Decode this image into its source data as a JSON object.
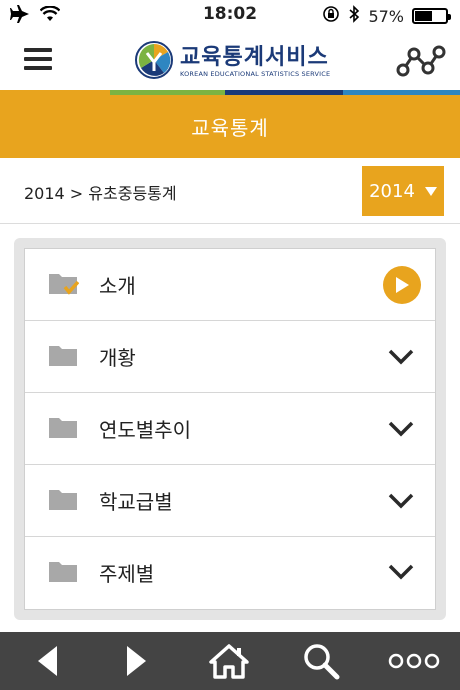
{
  "status_bar": {
    "time": "18:02",
    "battery_percent": "57%",
    "battery_level": 0.57,
    "icons": [
      "airplane-icon",
      "wifi-icon",
      "rotation-lock-icon",
      "bluetooth-icon",
      "battery-icon"
    ]
  },
  "header": {
    "logo_title": "교육통계서비스",
    "logo_subtitle": "KOREAN EDUCATIONAL STATISTICS SERVICE",
    "left_icon": "hamburger-menu-icon",
    "right_icon": "share-icon"
  },
  "stripe_colors": [
    "#e8a41e",
    "#7cb342",
    "#1b3a78",
    "#2e86c1"
  ],
  "page": {
    "title": "교육통계",
    "breadcrumb": "2014 > 유초중등통계",
    "year_selected": "2014"
  },
  "menu": {
    "items": [
      {
        "label": "소개",
        "icon": "folder-checked-icon",
        "action": "play-icon"
      },
      {
        "label": "개황",
        "icon": "folder-icon",
        "action": "chevron-down-icon"
      },
      {
        "label": "연도별추이",
        "icon": "folder-icon",
        "action": "chevron-down-icon"
      },
      {
        "label": "학교급별",
        "icon": "folder-icon",
        "action": "chevron-down-icon"
      },
      {
        "label": "주제별",
        "icon": "folder-icon",
        "action": "chevron-down-icon"
      }
    ]
  },
  "toolbar": {
    "items": [
      "back-icon",
      "forward-icon",
      "home-icon",
      "search-icon",
      "more-icon"
    ]
  },
  "colors": {
    "accent": "#e8a41e",
    "toolbar": "#444444",
    "brand": "#1b3a78"
  }
}
